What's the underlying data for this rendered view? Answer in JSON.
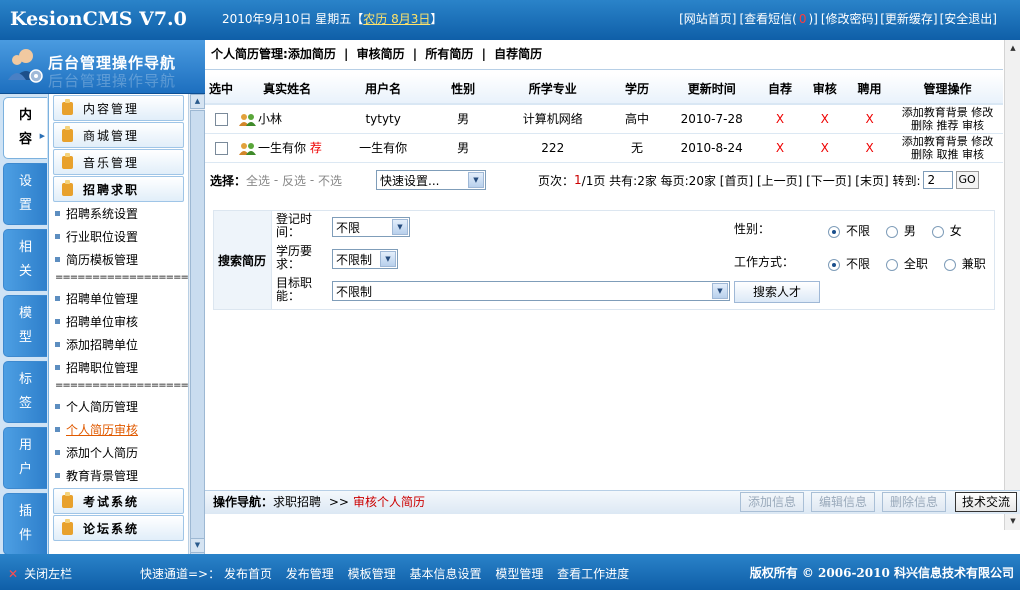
{
  "app": {
    "logo": "KesionCMS V7.0"
  },
  "topbar": {
    "date": "2010年9月10日 星期五【",
    "lunar": "农历 8月3日",
    "date_close": "】",
    "links": [
      "[网站首页]",
      "[查看短信(",
      "0",
      ")]",
      "[修改密码]",
      "[更新缓存]",
      "[安全退出]"
    ]
  },
  "nav": {
    "title": "后台管理操作导航",
    "title_shadow": "后台管理操作导航",
    "tabs": [
      "内容",
      "设置",
      "相关",
      "模型",
      "标签",
      "用户",
      "插件"
    ],
    "menu": {
      "top_buttons": [
        "内容管理",
        "商城管理",
        "音乐管理",
        "招聘求职"
      ],
      "group1": [
        "招聘系统设置",
        "行业职位设置",
        "简历模板管理"
      ],
      "separator": "==================",
      "group2": [
        "招聘单位管理",
        "招聘单位审核",
        "添加招聘单位",
        "招聘职位管理"
      ],
      "group3": [
        "个人简历管理",
        "个人简历审核",
        "添加个人简历",
        "教育背景管理"
      ],
      "bottom_buttons": [
        "考试系统",
        "论坛系统"
      ]
    }
  },
  "main": {
    "header": {
      "prefix": "个人简历管理:",
      "links": [
        "添加简历",
        "审核简历",
        "所有简历",
        "自荐简历"
      ],
      "sep": "|"
    },
    "table": {
      "columns": [
        "选中",
        "真实姓名",
        "用户名",
        "性别",
        "所学专业",
        "学历",
        "更新时间",
        "自荐",
        "审核",
        "聘用",
        "管理操作"
      ],
      "rows": [
        {
          "name": "小林",
          "recommend_tag": "",
          "username": "tytyty",
          "gender": "男",
          "major": "计算机网络",
          "edu": "高中",
          "updated": "2010-7-28",
          "self": "X",
          "audit": "X",
          "hire": "X",
          "ops1": "添加教育背景 修改",
          "ops2": "删除 推荐 审核"
        },
        {
          "name": "一生有你",
          "recommend_tag": "荐",
          "username": "一生有你",
          "gender": "男",
          "major": "222",
          "edu": "无",
          "updated": "2010-8-24",
          "self": "X",
          "audit": "X",
          "hire": "X",
          "ops1": "添加教育背景 修改",
          "ops2": "删除 取推 审核"
        }
      ]
    },
    "pager": {
      "select_label": "选择：",
      "select_all": "全选",
      "invert": "反选",
      "none": "不选",
      "quick": "快速设置...",
      "page_prefix": "页次：",
      "page_cur": "1",
      "page_rest": "/1页 共有:2家 每页:20家 [首页] [上一页] [下一页] [末页] 转到:",
      "goto_value": "2",
      "go": "GO"
    },
    "search": {
      "title": "搜索简历",
      "reg_label": "登记时间：",
      "reg_value": "不限",
      "edu_label": "学历要求：",
      "edu_value": "不限制",
      "job_label": "目标职能：",
      "job_value": "不限制",
      "gender_label": "性别：",
      "gender_opts": [
        "不限",
        "男",
        "女"
      ],
      "work_label": "工作方式：",
      "work_opts": [
        "不限",
        "全职",
        "兼职"
      ],
      "button": "搜索人才"
    }
  },
  "footer": {
    "nav_label": "操作导航：",
    "crumb": "求职招聘",
    "arrow": ">>",
    "current": "审核个人简历",
    "buttons": [
      "添加信息",
      "编辑信息",
      "删除信息",
      "技术交流"
    ]
  },
  "bottom": {
    "close": "关闭左栏",
    "quick_label": "快速通道=>：",
    "quick_links": [
      "发布首页",
      "发布管理",
      "模板管理",
      "基本信息设置",
      "模型管理",
      "查看工作进度"
    ],
    "copyright": "版权所有 © 2006-2010 科兴信息技术有限公司"
  },
  "colors": {
    "accent": "#1a6fbf",
    "header_bg": "#1e72bd",
    "alert": "#e00000"
  }
}
